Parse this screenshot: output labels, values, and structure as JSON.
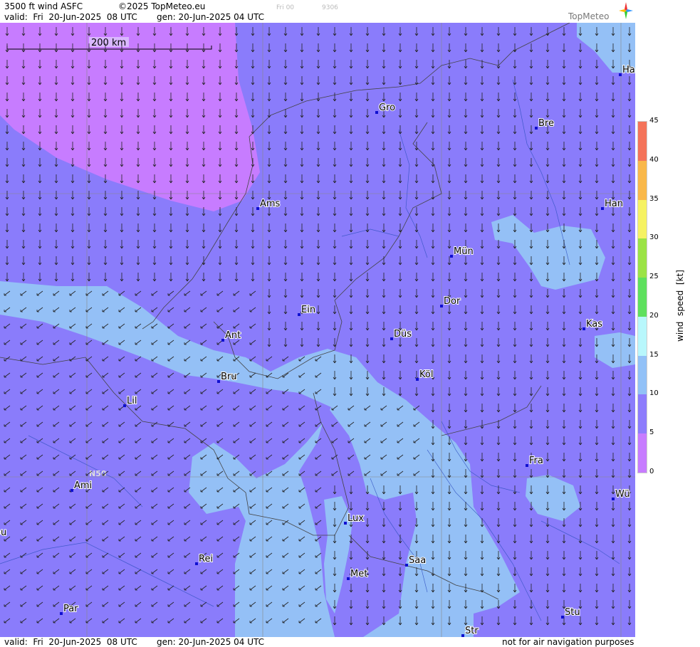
{
  "header": {
    "title": "3500 ft wind ASFC",
    "copyright": "©2025 TopMeteo.eu",
    "faint_day": "Fri 00",
    "faint_id": "9306",
    "valid": "valid:  Fri  20-Jun-2025  08 UTC",
    "gen": "gen: 20-Jun-2025 04 UTC",
    "logo": "TopMeteo"
  },
  "footer": {
    "valid": "valid:  Fri  20-Jun-2025  08 UTC",
    "gen": "gen: 20-Jun-2025 04 UTC",
    "disclaimer": "not for air navigation purposes"
  },
  "scale_bar": {
    "label": "200 km"
  },
  "grid_label": "N50",
  "cities": [
    {
      "name": "Gro"
    },
    {
      "name": "Bre"
    },
    {
      "name": "Ha"
    },
    {
      "name": "Ams"
    },
    {
      "name": "Han"
    },
    {
      "name": "Mün"
    },
    {
      "name": "Ein"
    },
    {
      "name": "Dor"
    },
    {
      "name": "Kas"
    },
    {
      "name": "Ant"
    },
    {
      "name": "Düs"
    },
    {
      "name": "Bru"
    },
    {
      "name": "Köl"
    },
    {
      "name": "Lil"
    },
    {
      "name": "Fra"
    },
    {
      "name": "Ami"
    },
    {
      "name": "Wü"
    },
    {
      "name": "Lux"
    },
    {
      "name": "ou"
    },
    {
      "name": "Rei"
    },
    {
      "name": "Saa"
    },
    {
      "name": "Met"
    },
    {
      "name": "Par"
    },
    {
      "name": "Stu"
    },
    {
      "name": "Str"
    }
  ],
  "legend": {
    "axis_label": "wind  speed  [kt]",
    "ticks": [
      "45",
      "40",
      "35",
      "30",
      "25",
      "20",
      "15",
      "10",
      "5",
      "0"
    ],
    "colors": {
      "0-5": "#c77cff",
      "5-10": "#8d7cfc",
      "10-15": "#92c1f7",
      "15-20": "#b8f7fc",
      "20-25": "#5ee05e",
      "25-30": "#9be346",
      "30-35": "#f6f262",
      "35-40": "#f9b84a",
      "40-45": "#f4735a"
    }
  },
  "map_colors": {
    "calm": "#c77cff",
    "light": "#8a7cfb",
    "moderate": "#94c0f6",
    "lines": "#333333",
    "rivers": "#3050c0",
    "city_marker": "#1010d0"
  }
}
